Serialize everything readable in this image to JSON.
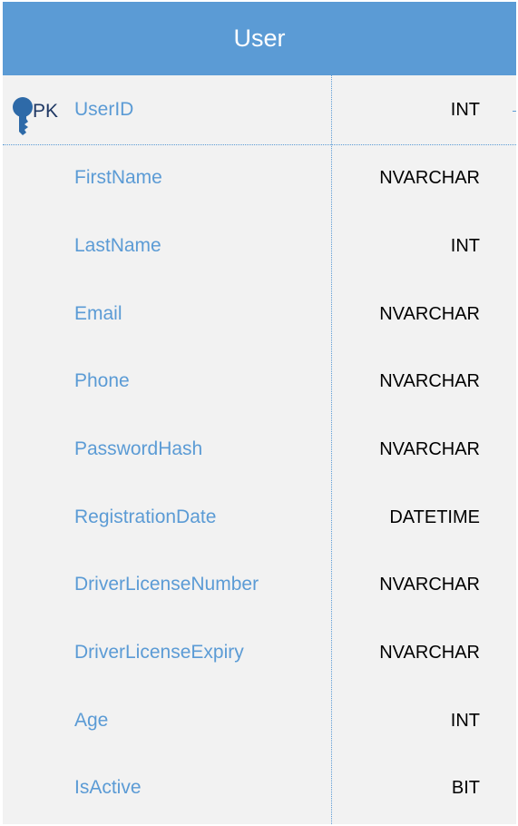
{
  "entity": {
    "title": "User",
    "primary_key": {
      "label": "PK",
      "field": "UserID",
      "type": "INT"
    },
    "columns": [
      {
        "field": "FirstName",
        "type": "NVARCHAR"
      },
      {
        "field": "LastName",
        "type": "INT"
      },
      {
        "field": "Email",
        "type": "NVARCHAR"
      },
      {
        "field": "Phone",
        "type": "NVARCHAR"
      },
      {
        "field": "PasswordHash",
        "type": "NVARCHAR"
      },
      {
        "field": "RegistrationDate",
        "type": "DATETIME"
      },
      {
        "field": "DriverLicenseNumber",
        "type": "NVARCHAR"
      },
      {
        "field": "DriverLicenseExpiry",
        "type": "NVARCHAR"
      },
      {
        "field": "Age",
        "type": "INT"
      },
      {
        "field": "IsActive",
        "type": "BIT"
      }
    ]
  },
  "colors": {
    "header": "#5b9bd5",
    "body": "#f2f2f2",
    "field_text": "#5b9bd5",
    "type_text": "#000000",
    "pk_text": "#1f3864"
  },
  "icons": {
    "primary_key": "key-icon"
  }
}
